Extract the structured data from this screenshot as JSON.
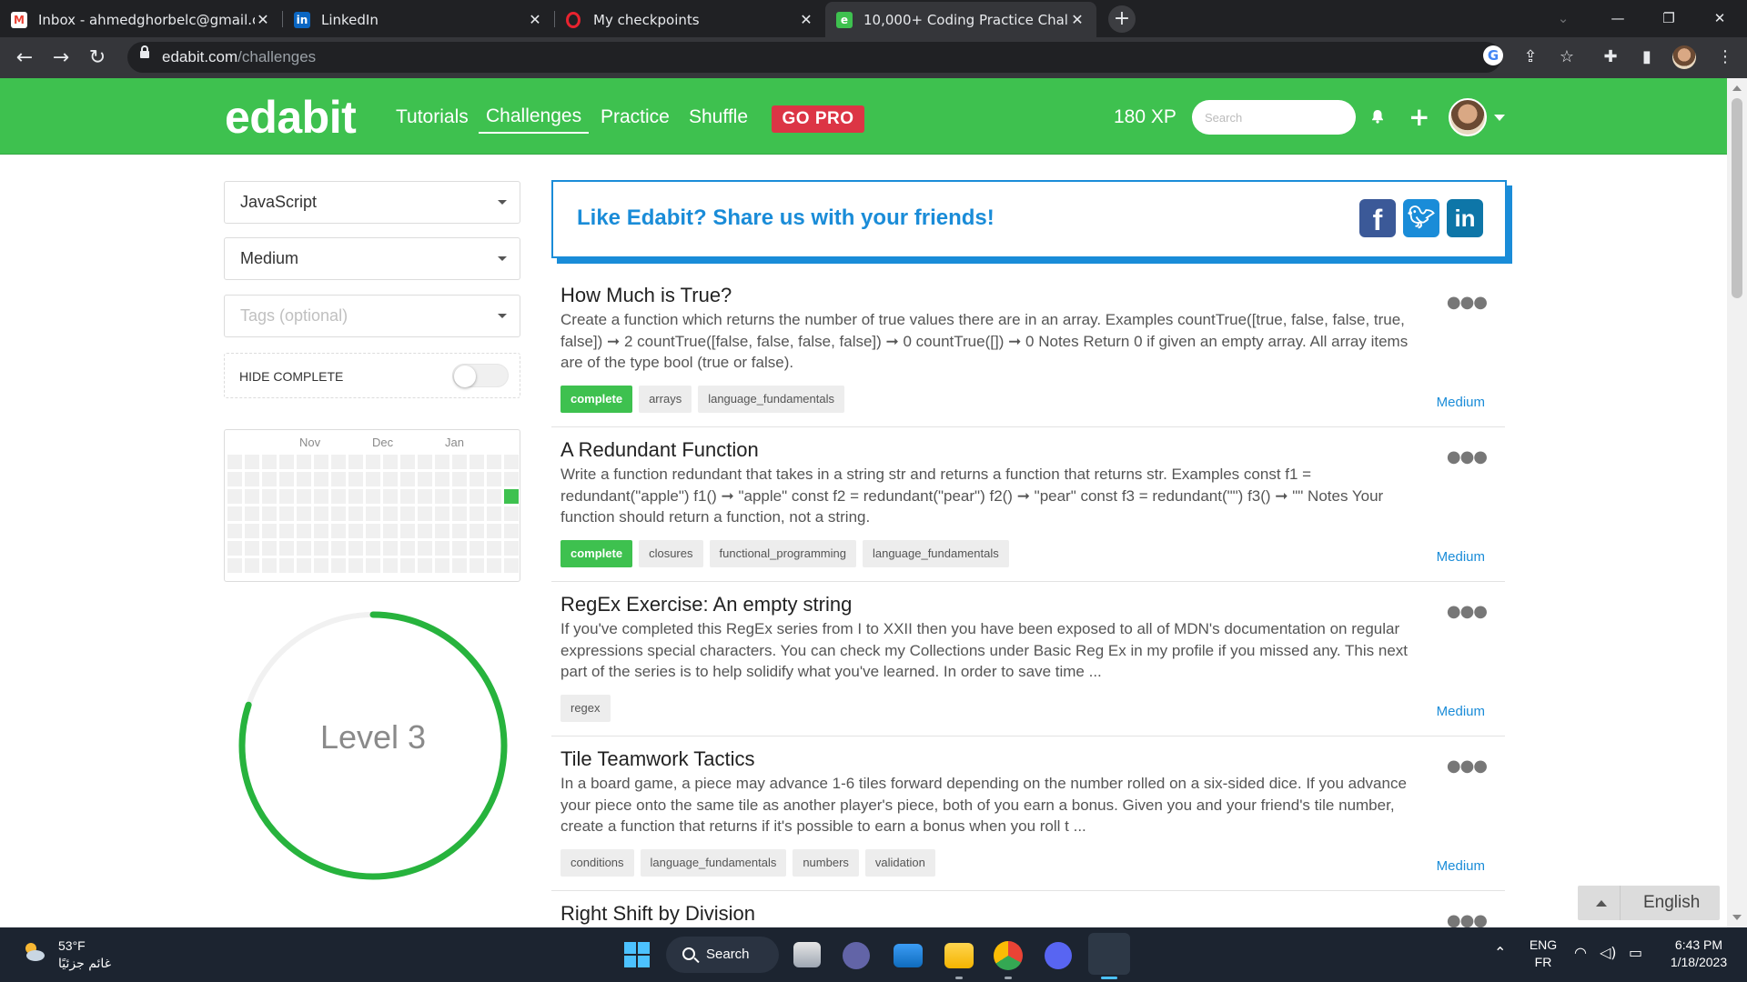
{
  "browser": {
    "tabs": [
      {
        "title": "Inbox - ahmedghorbelc@gmail.c",
        "icon": "gmail-icon"
      },
      {
        "title": "LinkedIn",
        "icon": "linkedin-icon"
      },
      {
        "title": "My checkpoints",
        "icon": "opera-icon"
      },
      {
        "title": "10,000+ Coding Practice Challen",
        "icon": "edabit-icon"
      }
    ],
    "url_host": "edabit.com",
    "url_path": "/challenges"
  },
  "header": {
    "logo": "edabit",
    "nav": [
      "Tutorials",
      "Challenges",
      "Practice",
      "Shuffle"
    ],
    "active_nav": "Challenges",
    "gopro": "GO PRO",
    "xp": "180 XP",
    "search_placeholder": "Search"
  },
  "sidebar": {
    "language": "JavaScript",
    "difficulty": "Medium",
    "tags_placeholder": "Tags (optional)",
    "hide_complete_label": "HIDE COMPLETE",
    "hide_complete_on": false,
    "calendar_months": [
      "Nov",
      "Dec",
      "Jan"
    ],
    "level_label": "Level 3",
    "level_progress": 0.8
  },
  "share": {
    "text": "Like Edabit? Share us with your friends!",
    "fb": "f",
    "tw": "t",
    "li": "in"
  },
  "challenges": [
    {
      "title": "How Much is True?",
      "desc": "Create a function which returns the number of true values there are in an array. Examples countTrue([true, false, false, true, false]) ➞ 2 countTrue([false, false, false, false]) ➞ 0 countTrue([]) ➞ 0 Notes Return 0 if given an empty array. All array items are of the type bool (true or false).",
      "tags": [
        "complete",
        "arrays",
        "language_fundamentals"
      ],
      "level": "Medium"
    },
    {
      "title": "A Redundant Function",
      "desc": "Write a function redundant that takes in a string str and returns a function that returns str. Examples const f1 = redundant(\"apple\") f1() ➞ \"apple\" const f2 = redundant(\"pear\") f2() ➞ \"pear\" const f3 = redundant(\"\") f3() ➞ \"\" Notes Your function should return a function, not a string.",
      "tags": [
        "complete",
        "closures",
        "functional_programming",
        "language_fundamentals"
      ],
      "level": "Medium"
    },
    {
      "title": "RegEx Exercise: An empty string",
      "desc": "If you've completed this RegEx series from I to XXII then you have been exposed to all of MDN's documentation on regular expressions special characters. You can check my Collections under Basic Reg Ex in my profile if you missed any. This next part of the series is to help solidify what you've learned. In order to save time ...",
      "tags": [
        "regex"
      ],
      "level": "Medium"
    },
    {
      "title": "Tile Teamwork Tactics",
      "desc": "In a board game, a piece may advance 1-6 tiles forward depending on the number rolled on a six-sided dice. If you advance your piece onto the same tile as another player's piece, both of you earn a bonus. Given you and your friend's tile number, create a function that returns if it's possible to earn a bonus when you roll t ...",
      "tags": [
        "conditions",
        "language_fundamentals",
        "numbers",
        "validation"
      ],
      "level": "Medium"
    },
    {
      "title": "Right Shift by Division",
      "desc": "",
      "tags": [],
      "level": ""
    }
  ],
  "language_button": "English",
  "taskbar": {
    "temp": "53°F",
    "weather": "غائم جزئيًا",
    "search": "Search",
    "lang_top": "ENG",
    "lang_bottom": "FR",
    "time": "6:43 PM",
    "date": "1/18/2023"
  },
  "colors": {
    "brand_green": "#3ec14f",
    "link_blue": "#1a8cd8",
    "gopro_red": "#dc3545"
  }
}
